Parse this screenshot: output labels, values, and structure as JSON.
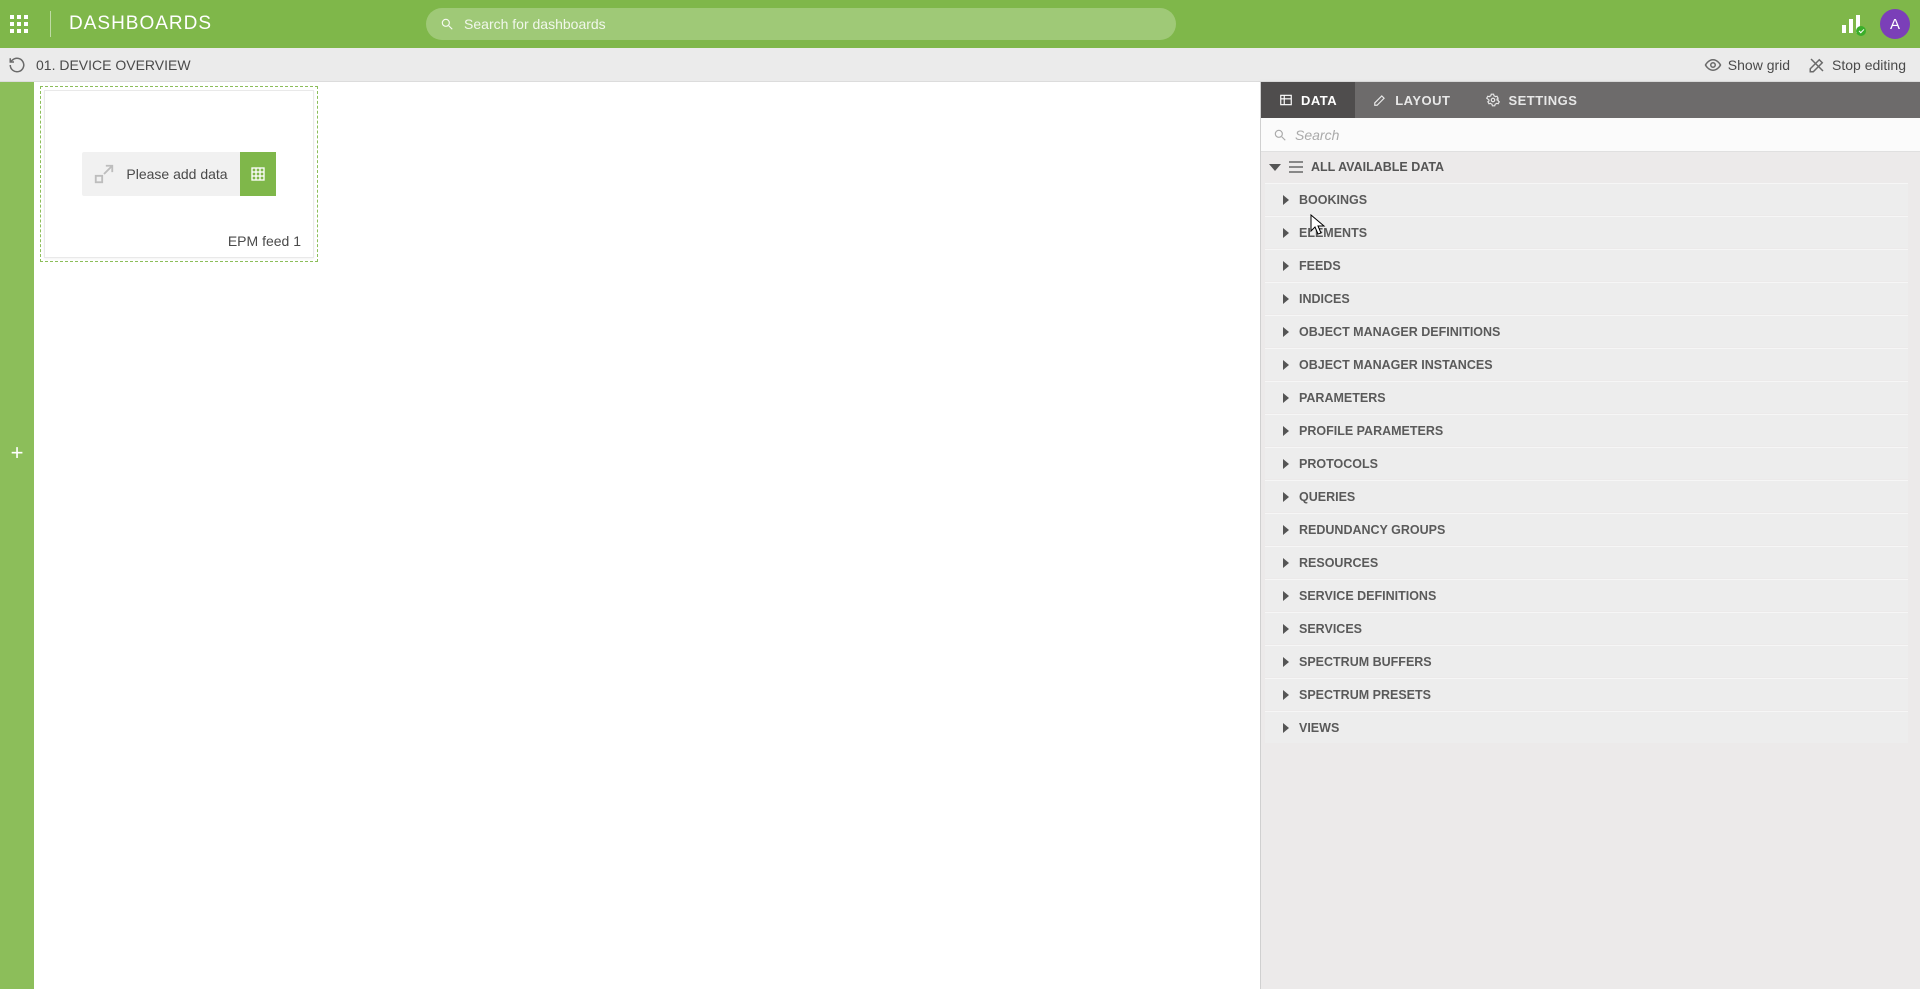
{
  "header": {
    "title": "DASHBOARDS",
    "search_placeholder": "Search for dashboards",
    "avatar_letter": "A"
  },
  "toolbar": {
    "dashboard_name": "01. DEVICE OVERVIEW",
    "show_grid": "Show grid",
    "stop_editing": "Stop editing"
  },
  "widget": {
    "add_data_label": "Please add data",
    "caption": "EPM feed 1"
  },
  "panel": {
    "tabs": {
      "data": "DATA",
      "layout": "LAYOUT",
      "settings": "SETTINGS"
    },
    "search_placeholder": "Search",
    "root_label": "ALL AVAILABLE DATA",
    "categories": [
      "BOOKINGS",
      "ELEMENTS",
      "FEEDS",
      "INDICES",
      "OBJECT MANAGER DEFINITIONS",
      "OBJECT MANAGER INSTANCES",
      "PARAMETERS",
      "PROFILE PARAMETERS",
      "PROTOCOLS",
      "QUERIES",
      "REDUNDANCY GROUPS",
      "RESOURCES",
      "SERVICE DEFINITIONS",
      "SERVICES",
      "SPECTRUM BUFFERS",
      "SPECTRUM PRESETS",
      "VIEWS"
    ]
  }
}
